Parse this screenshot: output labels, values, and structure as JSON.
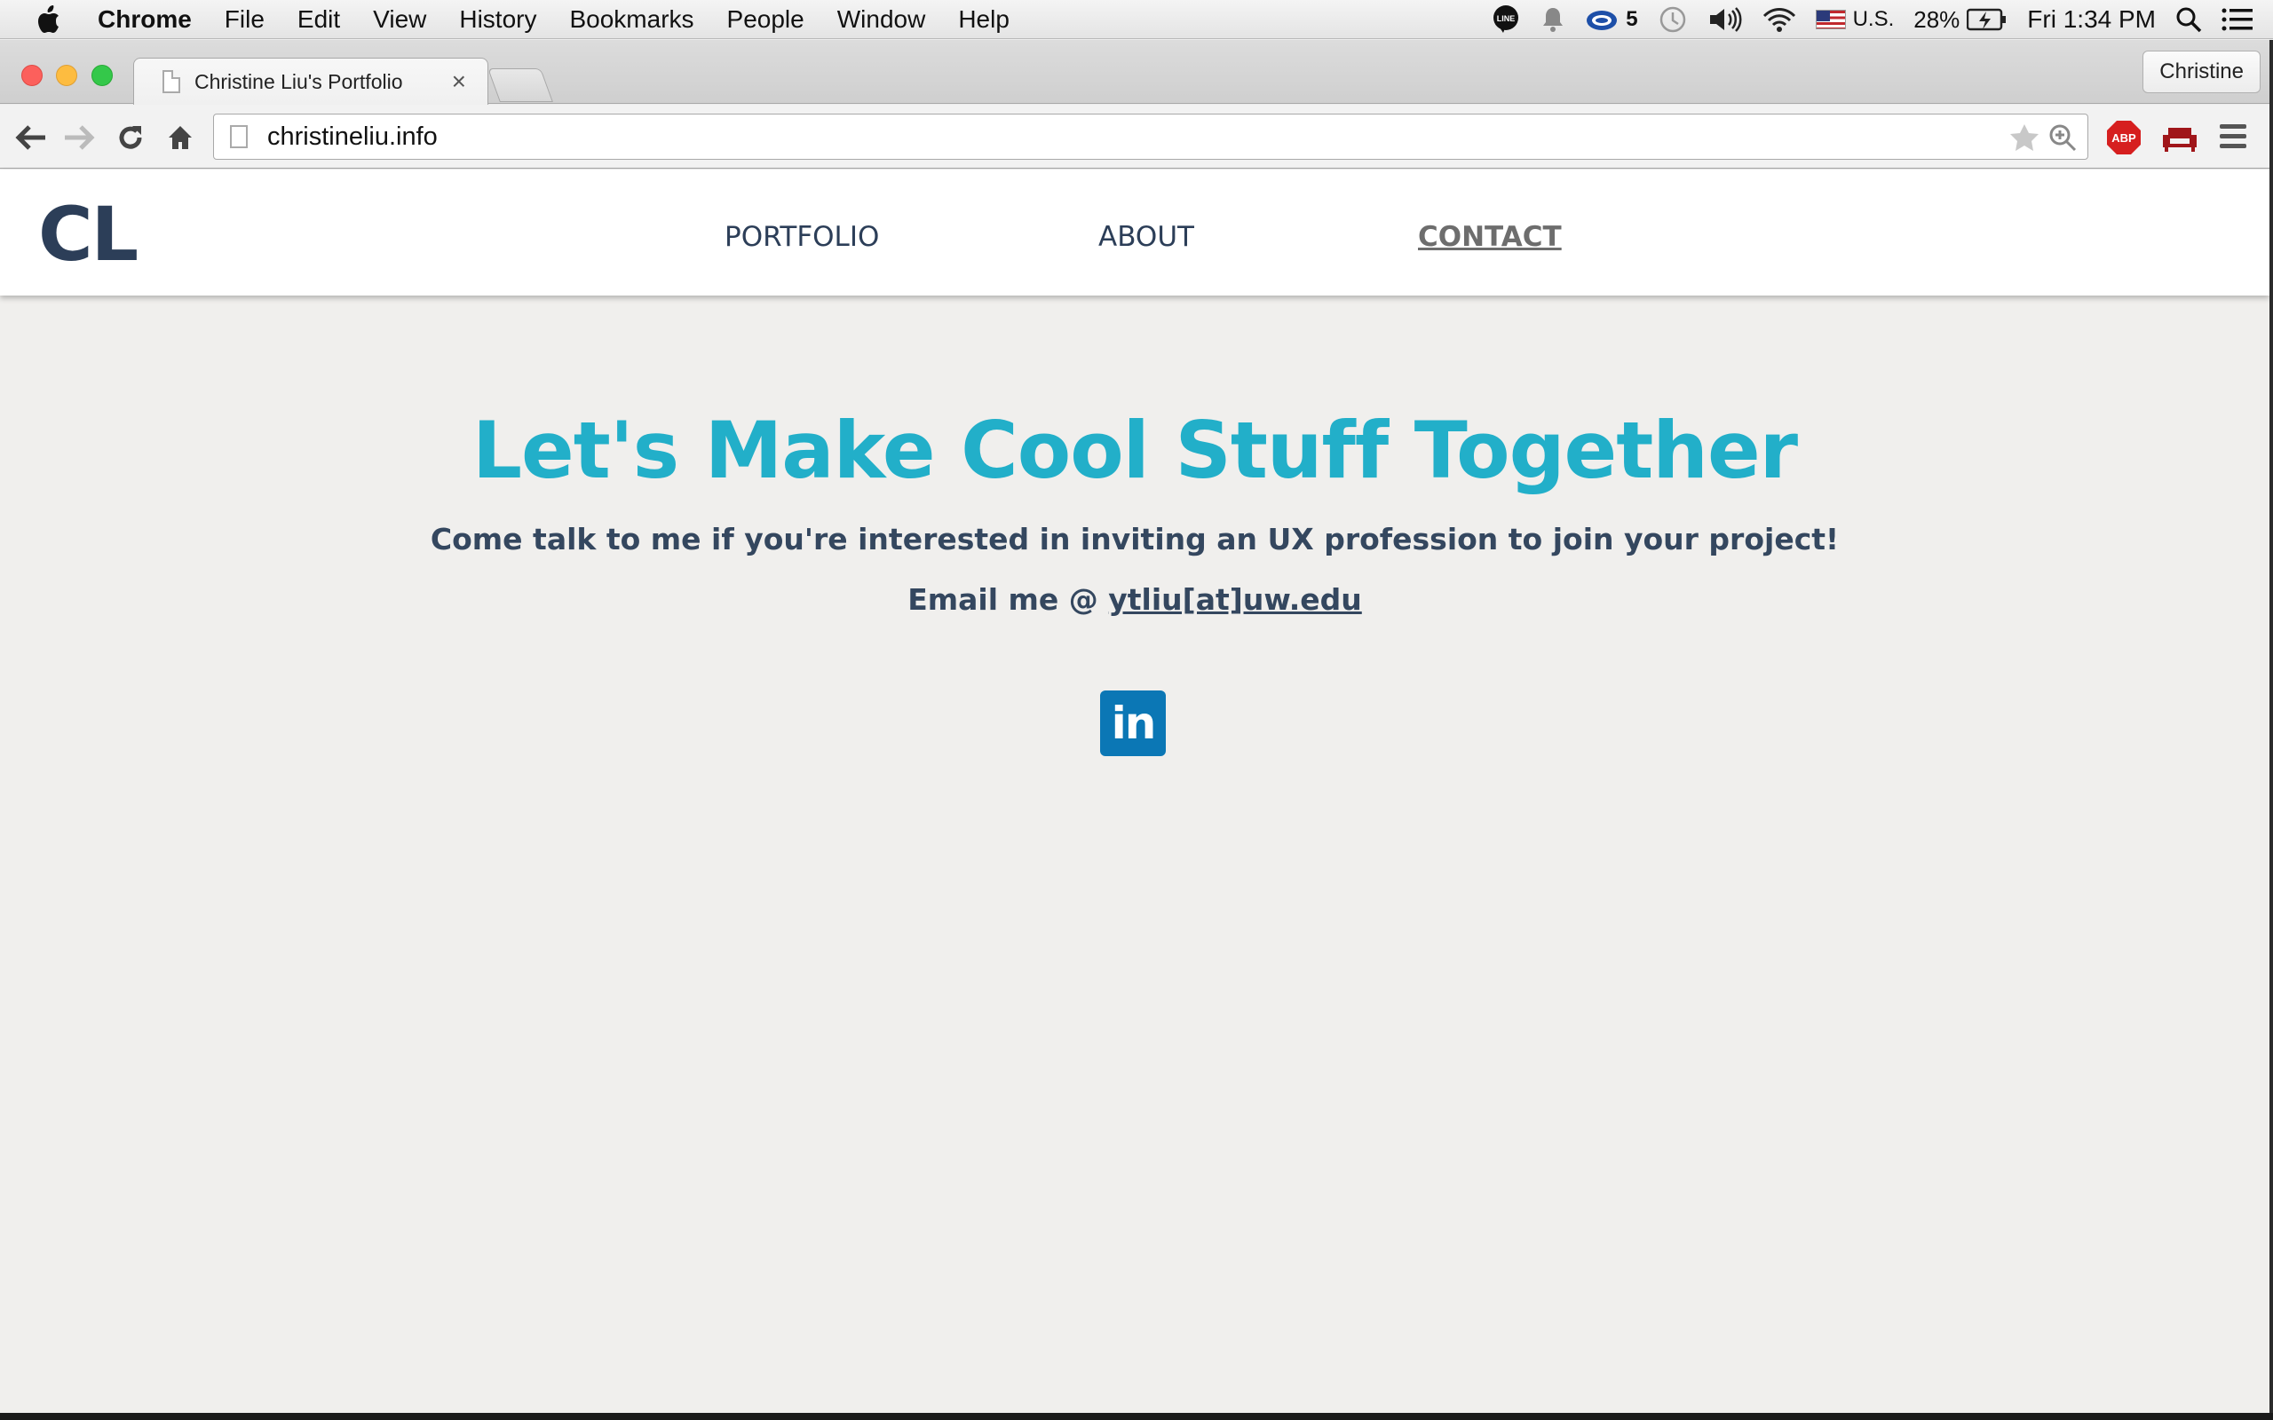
{
  "menubar": {
    "app_name": "Chrome",
    "items": [
      "File",
      "Edit",
      "View",
      "History",
      "Bookmarks",
      "People",
      "Window",
      "Help"
    ],
    "status": {
      "cloud_count": "5",
      "input_source": "U.S.",
      "battery": "28%",
      "clock": "Fri 1:34 PM"
    }
  },
  "browser": {
    "tab_title": "Christine Liu's Portfolio",
    "tab_close": "×",
    "profile_name": "Christine",
    "url": "christineliu.info",
    "extension_abp": "ABP"
  },
  "site": {
    "logo": "CL",
    "nav": {
      "portfolio": "PORTFOLIO",
      "about": "ABOUT",
      "contact": "CONTACT"
    },
    "headline": "Let's Make Cool Stuff Together",
    "subhead": "Come talk to me if you're interested in inviting an UX profession to join your project!",
    "email_prefix": "Email me @ ",
    "email_link": "ytliu[at]uw.edu",
    "linkedin_label": "in"
  },
  "colors": {
    "headline": "#22afc9",
    "text": "#34475f",
    "linkedin": "#0b77b5"
  }
}
